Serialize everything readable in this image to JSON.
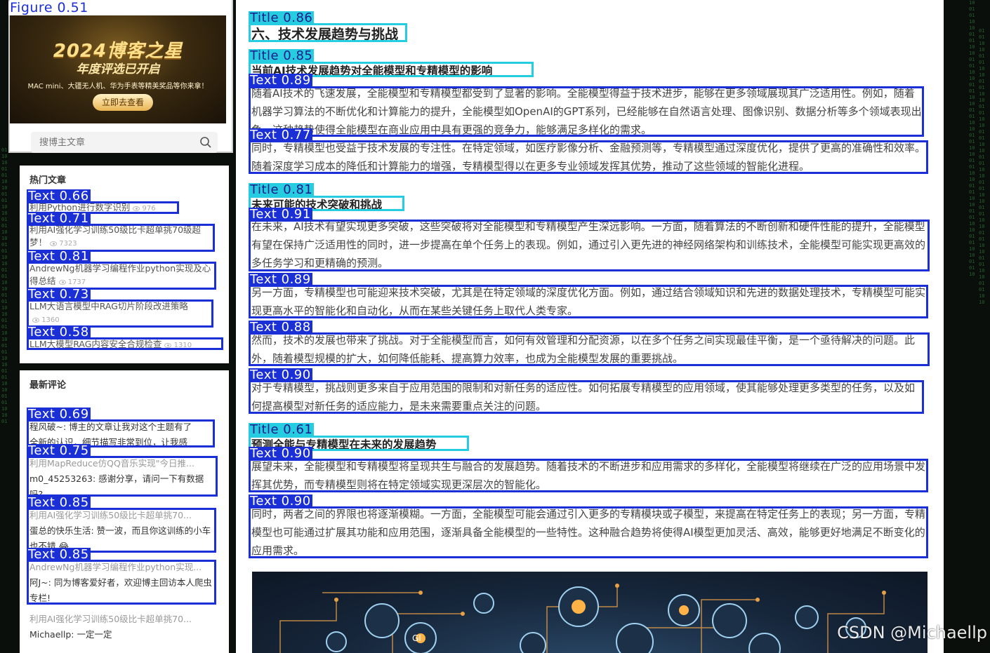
{
  "figure_label": "Figure 0.51",
  "banner": {
    "headline": "2024博客之星",
    "subline": "年度评选已开启",
    "prize_line": "MAC mini、大疆无人机、华为手表等精美奖品等你来拿！",
    "cta": "立即去查看"
  },
  "search": {
    "placeholder": "搜博主文章",
    "icon": "search-icon"
  },
  "hot_articles": {
    "heading": "热门文章",
    "items": [
      {
        "label": "Text 0.66",
        "title": "利用Python进行数字识别",
        "views": "976"
      },
      {
        "label": "Text 0.71",
        "title": "利用AI强化学习训练50级比卡超单挑70级超梦！",
        "views": "7323"
      },
      {
        "label": "Text 0.81",
        "title": "AndrewNg机器学习编程作业python实现及心得总结",
        "views": "1737"
      },
      {
        "label": "Text 0.73",
        "title": "LLM大语言模型中RAG切片阶段改进策略",
        "views": "1360"
      },
      {
        "label": "Text 0.58",
        "title": "LLM大模型RAG内容安全合规检查",
        "views": "1310"
      }
    ]
  },
  "recent_comments": {
    "heading": "最新评论",
    "items": [
      {
        "label": "Text 0.69",
        "line1": "程风破~: 博主的文章让我对这个主题有了",
        "line2": "全新的认识，细节描写非常到位，让我感"
      },
      {
        "label": "Text 0.75",
        "line1": "利用MapReduce仿QQ音乐实现\"今日推...",
        "line2": "m0_45253263: 感谢分享，请问一下有数据吗?"
      },
      {
        "label": "Text 0.85",
        "line1": "利用AI强化学习训练50级比卡超单挑70...",
        "line2": "蛋总的快乐生活: 赞一波，而且你这训练的小车也不错 😂"
      },
      {
        "label": "Text 0.85",
        "line1": "AndrewNg机器学习编程作业python实现...",
        "line2": "阿J~: 同为博客爱好者，欢迎博主回访本人爬虫专栏!"
      },
      {
        "label": "",
        "line1": "利用AI强化学习训练50级比卡超单挑70...",
        "line2": "Michaellp: 一定一定"
      }
    ]
  },
  "main": {
    "section_label": "Title 0.86",
    "section_title": "六、技术发展趋势与挑战",
    "blocks": [
      {
        "label": "Title 0.85",
        "title": "当前AI技术发展趋势对全能模型和专精模型的影响"
      },
      {
        "label": "Text 0.89",
        "text": "随着AI技术的飞速发展，全能模型和专精模型都受到了显著的影响。全能模型得益于技术进步，能够在更多领域展现其广泛适用性。例如，随着机器学习算法的不断优化和计算能力的提升，全能模型如OpenAI的GPT系列，已经能够在自然语言处理、图像识别、数据分析等多个领域表现出色。这种趋势使得全能模型在商业应用中具有更强的竞争力，能够满足多样化的需求。"
      },
      {
        "label": "Text 0.77",
        "text": "同时，专精模型也受益于技术发展的专注性。在特定领域，如医疗影像分析、金融预测等，专精模型通过深度优化，提供了更高的准确性和效率。随着深度学习成本的降低和计算能力的增强，专精模型得以在更多专业领域发挥其优势，推动了这些领域的智能化进程。"
      },
      {
        "label": "Title 0.81",
        "title": "未来可能的技术突破和挑战"
      },
      {
        "label": "Text 0.91",
        "text": "在未来，AI技术有望实现更多突破，这些突破将对全能模型和专精模型产生深远影响。一方面，随着算法的不断创新和硬件性能的提升，全能模型有望在保持广泛适用性的同时，进一步提高在单个任务上的表现。例如，通过引入更先进的神经网络架构和训练技术，全能模型可能实现更高效的多任务学习和更精确的预测。"
      },
      {
        "label": "Text 0.89",
        "text": "另一方面，专精模型也可能迎来技术突破，尤其是在特定领域的深度优化方面。例如，通过结合领域知识和先进的数据处理技术，专精模型可能实现更高水平的智能化和自动化，从而在某些关键任务上取代人类专家。"
      },
      {
        "label": "Text 0.88",
        "text": "然而，技术的发展也带来了挑战。对于全能模型而言，如何有效管理和分配资源，以在多个任务之间实现最佳平衡，是一个亟待解决的问题。此外，随着模型规模的扩大，如何降低能耗、提高算力效率，也成为全能模型发展的重要挑战。"
      },
      {
        "label": "Text 0.90",
        "text": "对于专精模型，挑战则更多来自于应用范围的限制和对新任务的适应性。如何拓展专精模型的应用领域，使其能够处理更多类型的任务，以及如何提高模型对新任务的适应能力，是未来需要重点关注的问题。"
      },
      {
        "label": "Title 0.61",
        "title": "预测全能与专精模型在未来的发展趋势"
      },
      {
        "label": "Text 0.90",
        "text": "展望未来，全能模型和专精模型将呈现共生与融合的发展趋势。随着技术的不断进步和应用需求的多样化，全能模型将继续在广泛的应用场景中发挥其优势，而专精模型则将在特定领域实现更深层次的智能化。"
      },
      {
        "label": "Text 0.90",
        "text": "同时，两者之间的界限也将逐渐模糊。一方面，全能模型可能会通过引入更多的专精模块或子模型，来提高在特定任务上的表现；另一方面，专精模型也可能通过扩展其功能和应用范围，逐渐具备全能模型的一些特性。这种融合趋势将使得AI模型更加灵活、高效，能够更好地满足不断变化的应用需求。"
      }
    ]
  },
  "watermark": "CSDN @Michaellp",
  "colors": {
    "detection_text": "#1a2fd6",
    "detection_title": "#26cde0"
  }
}
